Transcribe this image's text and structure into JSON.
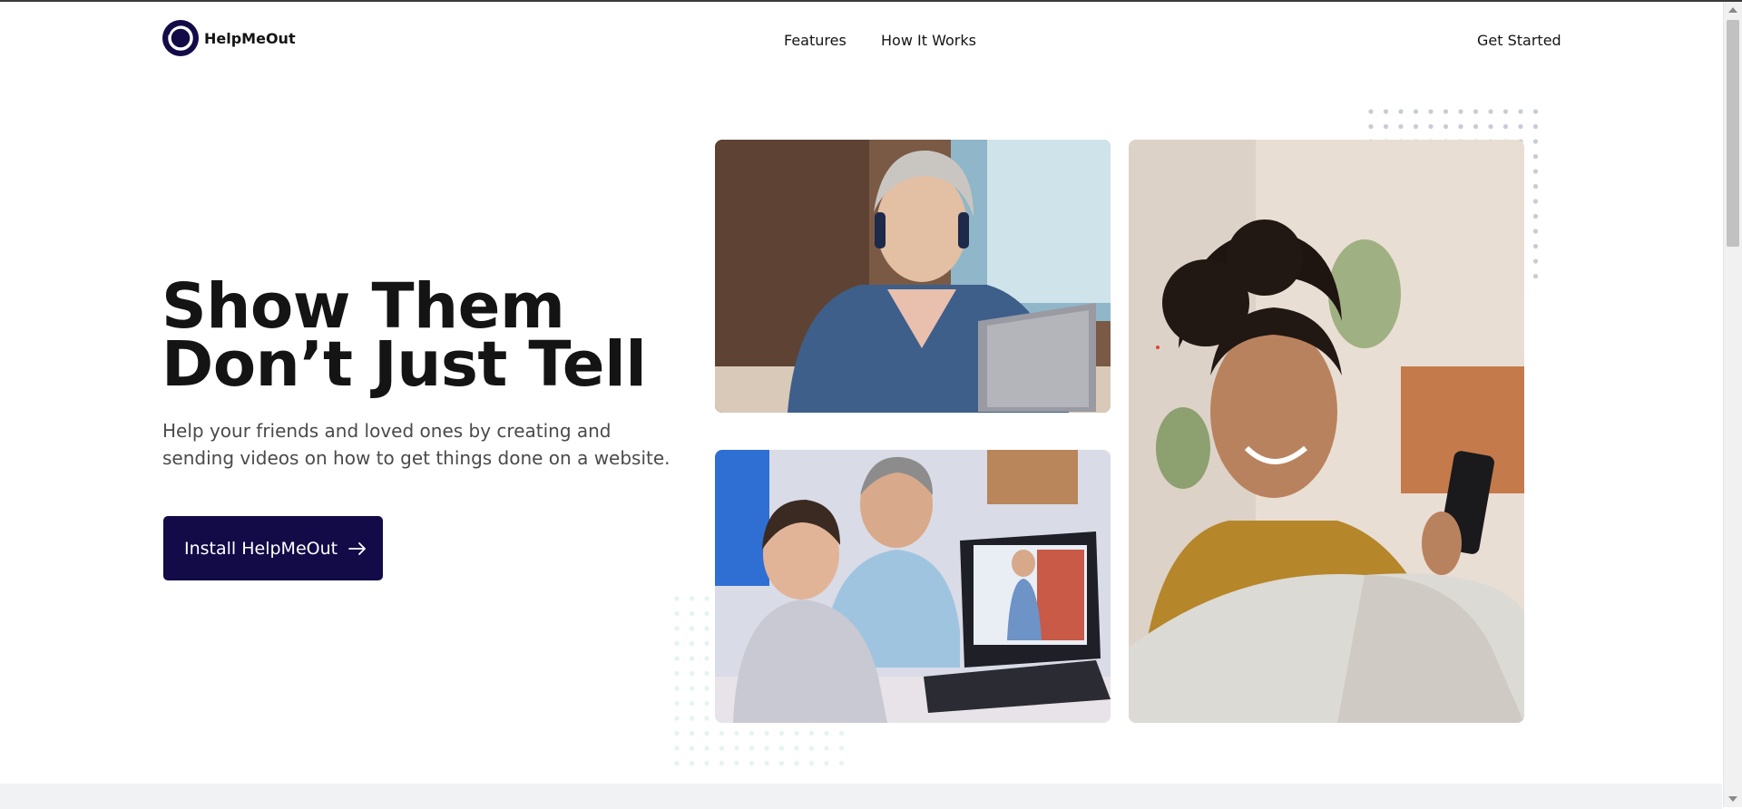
{
  "brand": {
    "name": "HelpMeOut",
    "color": "#120b48"
  },
  "nav": {
    "features": "Features",
    "how_it_works": "How It Works",
    "get_started": "Get Started"
  },
  "hero": {
    "headline_line1": "Show Them",
    "headline_line2": "Don’t Just Tell",
    "subtext": "Help your friends and loved ones by creating and sending videos on how to get things done on a website.",
    "cta_label": "Install HelpMeOut",
    "cta_icon": "arrow-right-icon"
  },
  "images": [
    {
      "name": "woman-headphones-laptop-photo"
    },
    {
      "name": "father-son-laptop-photo"
    },
    {
      "name": "woman-smiling-phone-photo"
    }
  ]
}
